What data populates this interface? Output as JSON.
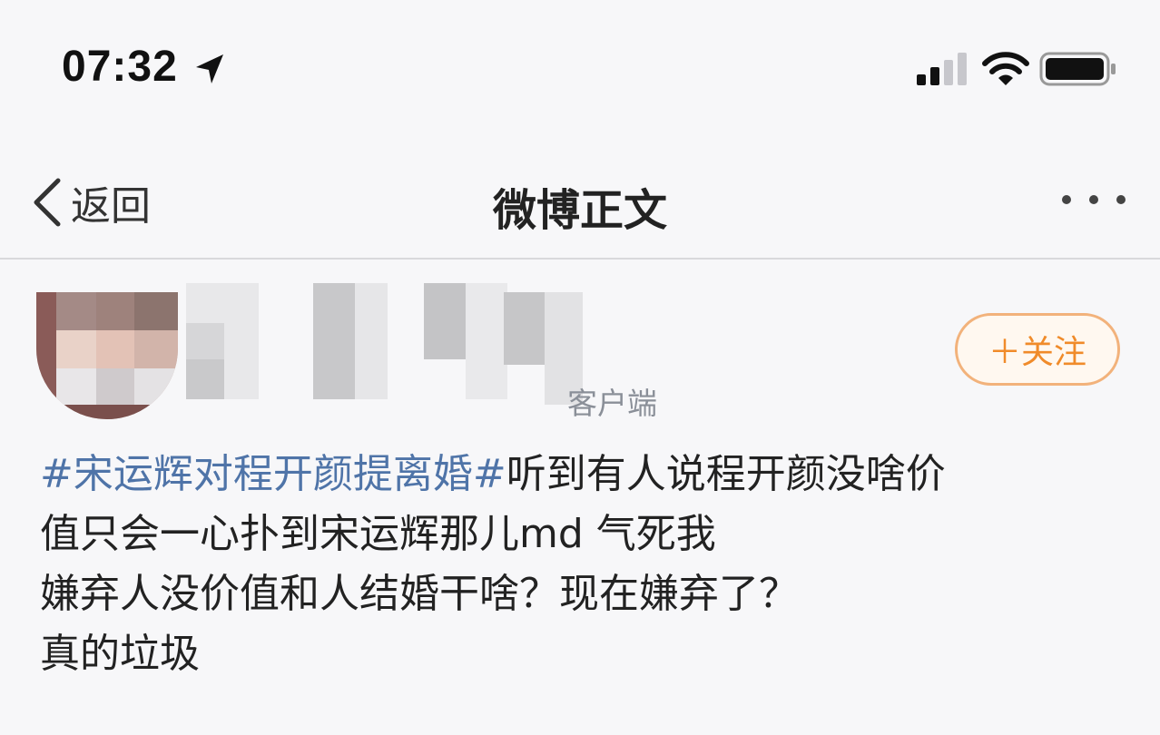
{
  "status_bar": {
    "time": "07:32",
    "icons": [
      "location-arrow-icon",
      "cellular-signal-icon",
      "wifi-icon",
      "battery-icon"
    ]
  },
  "nav": {
    "back_label": "返回",
    "title": "微博正文",
    "icons": [
      "chevron-left-icon",
      "more-icon"
    ]
  },
  "post": {
    "meta_suffix": "客户端",
    "follow_label": "＋关注",
    "hashtag": "#宋运辉对程开颜提离婚#",
    "text_lines": [
      "听到有人说程开颜没啥价",
      "值只会一心扑到宋运辉那儿md 气死我",
      "嫌弃人没价值和人结婚干啥？现在嫌弃了？",
      "真的垃圾"
    ]
  },
  "colors": {
    "hashtag": "#4f74a8",
    "follow_accent": "#f08b2a",
    "meta_gray": "#8a8f98"
  }
}
